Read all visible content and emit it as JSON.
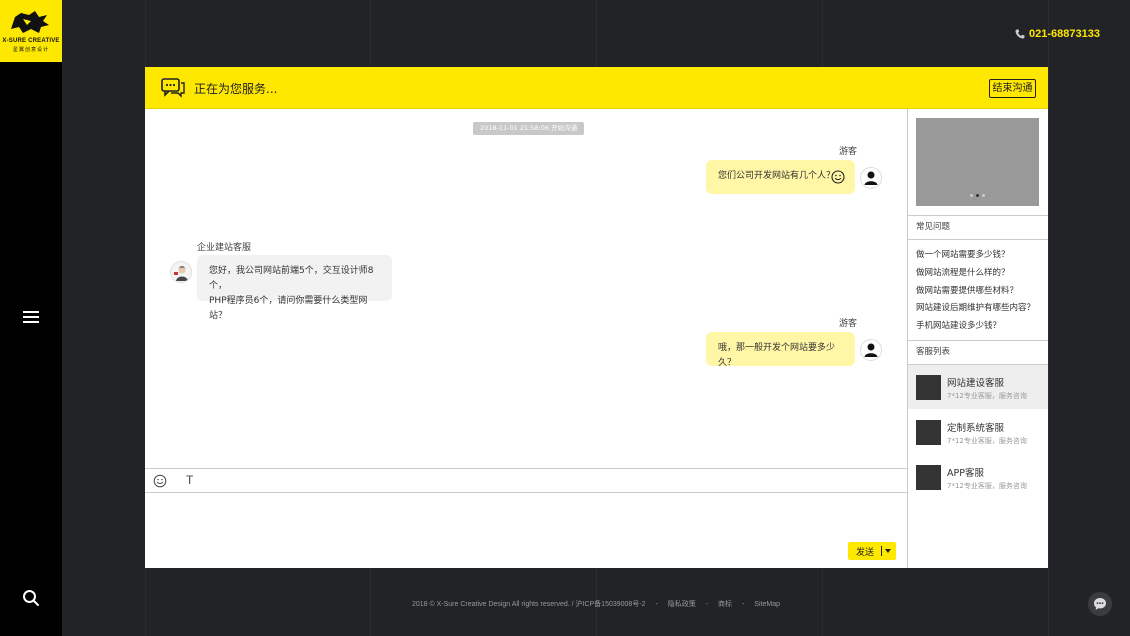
{
  "brand": {
    "name": "X-SURE CREATIVE",
    "subtitle": "星翼创意设计",
    "accent": "#ffe800"
  },
  "phone": "021-68873133",
  "header": {
    "title": "正在为您服务...",
    "end_button": "结束沟通"
  },
  "chat": {
    "timestamp": "2018-11-01 21:58:06 开始沟通",
    "messages": [
      {
        "sender": "游客",
        "text": "您们公司开发网站有几个人？"
      },
      {
        "sender": "企业建站客服",
        "line1": "您好，我公司网站前端5个，交互设计师8个，",
        "line2": "PHP程序员6个，请问你需要什么类型网站？"
      },
      {
        "sender": "游客",
        "text": "哦，那一般开发个网站要多少久？"
      }
    ]
  },
  "toolbar": {
    "text_tool": "T"
  },
  "send_button": "发送",
  "faq": {
    "title": "常见问题",
    "items": [
      "做一个网站需要多少钱？",
      "做网站流程是什么样的？",
      "做网站需要提供哪些材料？",
      "网站建设后期维护有哪些内容？",
      "手机网站建设多少钱？"
    ]
  },
  "service_list": {
    "title": "客服列表",
    "items": [
      {
        "name": "网站建设客服",
        "desc": "7*12专业客服，服务咨询"
      },
      {
        "name": "定制系统客服",
        "desc": "7*12专业客服，服务咨询"
      },
      {
        "name": "APP客服",
        "desc": "7*12专业客服，服务咨询"
      }
    ]
  },
  "footer": {
    "copyright": "2018 © X-Sure Creative Design All rights reserved. / 沪ICP备15039008号-2",
    "links": [
      "隐私政策",
      "商标",
      "SiteMap"
    ],
    "separator": "-"
  }
}
